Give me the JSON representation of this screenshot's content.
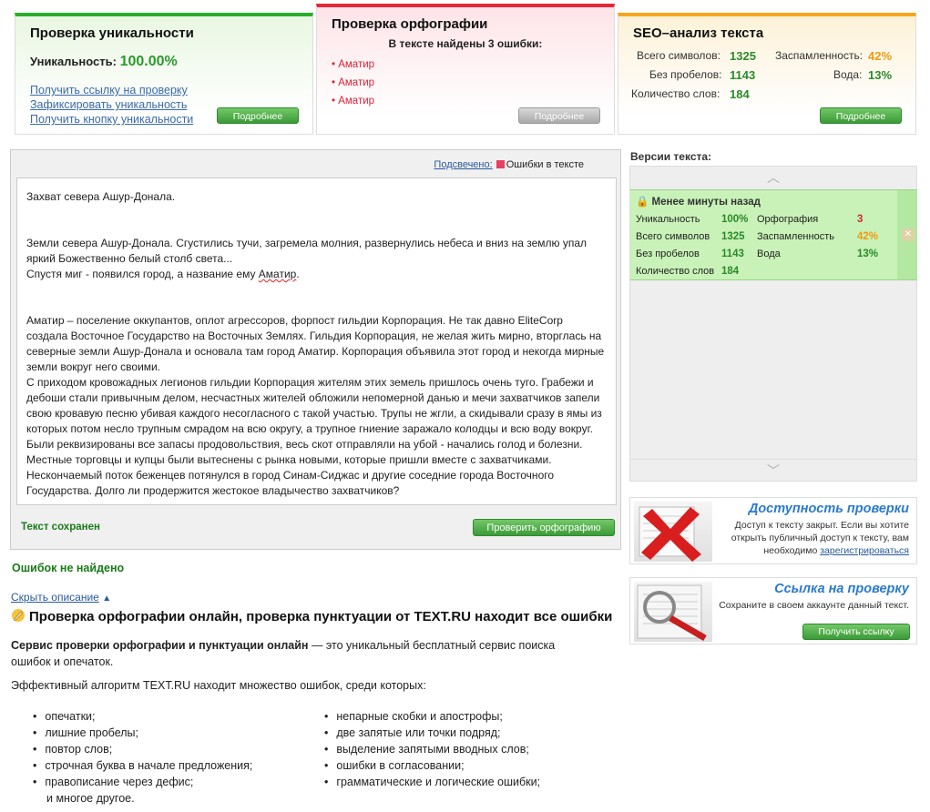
{
  "uniqueness_card": {
    "title": "Проверка уникальности",
    "uniqueness_label": "Уникальность:",
    "uniqueness_value": "100.00%",
    "links": [
      "Получить ссылку на проверку",
      "Зафиксировать уникальность",
      "Получить кнопку уникальности"
    ],
    "more_label": "Подробнее"
  },
  "spelling_card": {
    "title": "Проверка орфографии",
    "subtitle": "В тексте найдены 3 ошибки:",
    "errors": [
      "Аматир",
      "Аматир",
      "Аматир"
    ],
    "more_label": "Подробнее"
  },
  "seo_card": {
    "title": "SEO–анализ текста",
    "total_chars_label": "Всего символов:",
    "total_chars": "1325",
    "no_spaces_label": "Без пробелов:",
    "no_spaces": "1143",
    "word_count_label": "Количество слов:",
    "word_count": "184",
    "spam_label": "Заспамленность:",
    "spam": "42%",
    "water_label": "Вода:",
    "water": "13%",
    "more_label": "Подробнее"
  },
  "editor": {
    "legend_link": "Подсвечено:",
    "legend_text": "Ошибки в тексте",
    "p1": "Захват севера Ашур-Донала.",
    "p2": "Земли севера Ашур-Донала. Сгустились тучи, загремела молния, развернулись небеса и вниз на землю упал яркий Божественно белый столб света...",
    "p3_before": "Спустя миг - появился город, а название ему ",
    "p3_err": "Аматир",
    "p3_after": ".",
    "p4_err": "Аматир",
    "p4_rest": " – поселение оккупантов, оплот агрессоров, форпост гильдии Корпорация. Не так давно EliteCorp создала Восточное Государство на Восточных Землях. Гильдия Корпорация, не желая жить мирно, вторглась на северные земли Ашур-Донала и основала там город ",
    "p4_err2": "Аматир",
    "p4_rest2": ". Корпорация объявила этот город и некогда мирные земли вокруг него своими.",
    "p5": "С приходом кровожадных легионов гильдии Корпорация жителям этих земель пришлось очень туго. Грабежи и дебоши стали привычным делом, несчастных жителей обложили непомерной данью и мечи захватчиков запели свою кровавую песню убивая каждого несогласного с такой участью. Трупы не жгли, а скидывали сразу в ямы из которых потом несло трупным смрадом на всю округу, а трупное гниение заражало колодцы и всю воду вокруг. Были реквизированы все запасы продовольствия, весь скот отправляли на убой - начались голод и болезни. Местные торговцы и купцы были вытеснены с рынка новыми, которые пришли вместе с захватчиками. Нескончаемый поток беженцев потянулся в город Синам-Сиджас и другие соседние города Восточного Государства. Долго ли продержится жестокое владычество захватчиков?",
    "saved_label": "Текст сохранен",
    "check_button": "Проверить орфографию"
  },
  "result": {
    "no_errors": "Ошибок не найдено",
    "hide_desc": "Скрыть описание"
  },
  "description": {
    "title": "Проверка орфографии онлайн, проверка пунктуации от TEXT.RU находит все ошибки",
    "p1_bold": "Сервис проверки орфографии и пунктуации онлайн",
    "p1_rest": " — это уникальный бесплатный сервис поиска ошибок и опечаток.",
    "p2": "Эффективный алгоритм TEXT.RU находит множество ошибок, среди которых:",
    "list_left": [
      "опечатки;",
      "лишние пробелы;",
      "повтор слов;",
      "строчная буква в начале предложения;",
      "правописание через дефис;"
    ],
    "list_left_extra": "и многое другое.",
    "list_right": [
      "непарные скобки и апострофы;",
      "две запятые или точки подряд;",
      "выделение запятыми вводных слов;",
      "ошибки в согласовании;",
      "грамматические и логические ошибки;"
    ]
  },
  "versions": {
    "title": "Версии текста:",
    "item_title": "Менее минуты назад",
    "uniqueness_label": "Уникальность",
    "uniqueness": "100%",
    "spelling_label": "Орфография",
    "spelling": "3",
    "total_label": "Всего символов",
    "total": "1325",
    "spam_label": "Заспамленность",
    "spam": "42%",
    "no_spaces_label": "Без пробелов",
    "no_spaces": "1143",
    "water_label": "Вода",
    "water": "13%",
    "words_label": "Количество слов",
    "words": "184"
  },
  "promo_access": {
    "title": "Доступность проверки",
    "text": "Доступ к тексту закрыт. Если вы хотите открыть публичный доступ к тексту, вам необходимо",
    "link": "зарегистрироваться"
  },
  "promo_link": {
    "title": "Ссылка на проверку",
    "text": "Сохраните в своем аккаунте данный текст.",
    "button": "Получить ссылку"
  }
}
